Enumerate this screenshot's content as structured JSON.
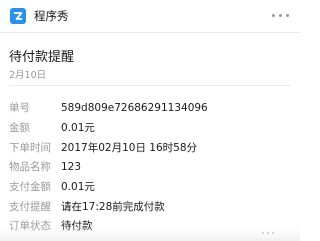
{
  "header": {
    "app_name": "程序秀",
    "more_icon": "ellipsis-icon",
    "accent_color": "#2a90e8"
  },
  "message": {
    "title": "待付款提醒",
    "date": "2月10日"
  },
  "rows": [
    {
      "label": "单号",
      "value": "589d809e72686291134096"
    },
    {
      "label": "金额",
      "value": "0.01元"
    },
    {
      "label": "下单时间",
      "value": "2017年02月10日 16时58分"
    },
    {
      "label": "物品名称",
      "value": "123"
    },
    {
      "label": "支付金额",
      "value": "0.01元"
    },
    {
      "label": "支付提醒",
      "value": "请在17:28前完成付款"
    },
    {
      "label": "订单状态",
      "value": "待付款"
    }
  ]
}
